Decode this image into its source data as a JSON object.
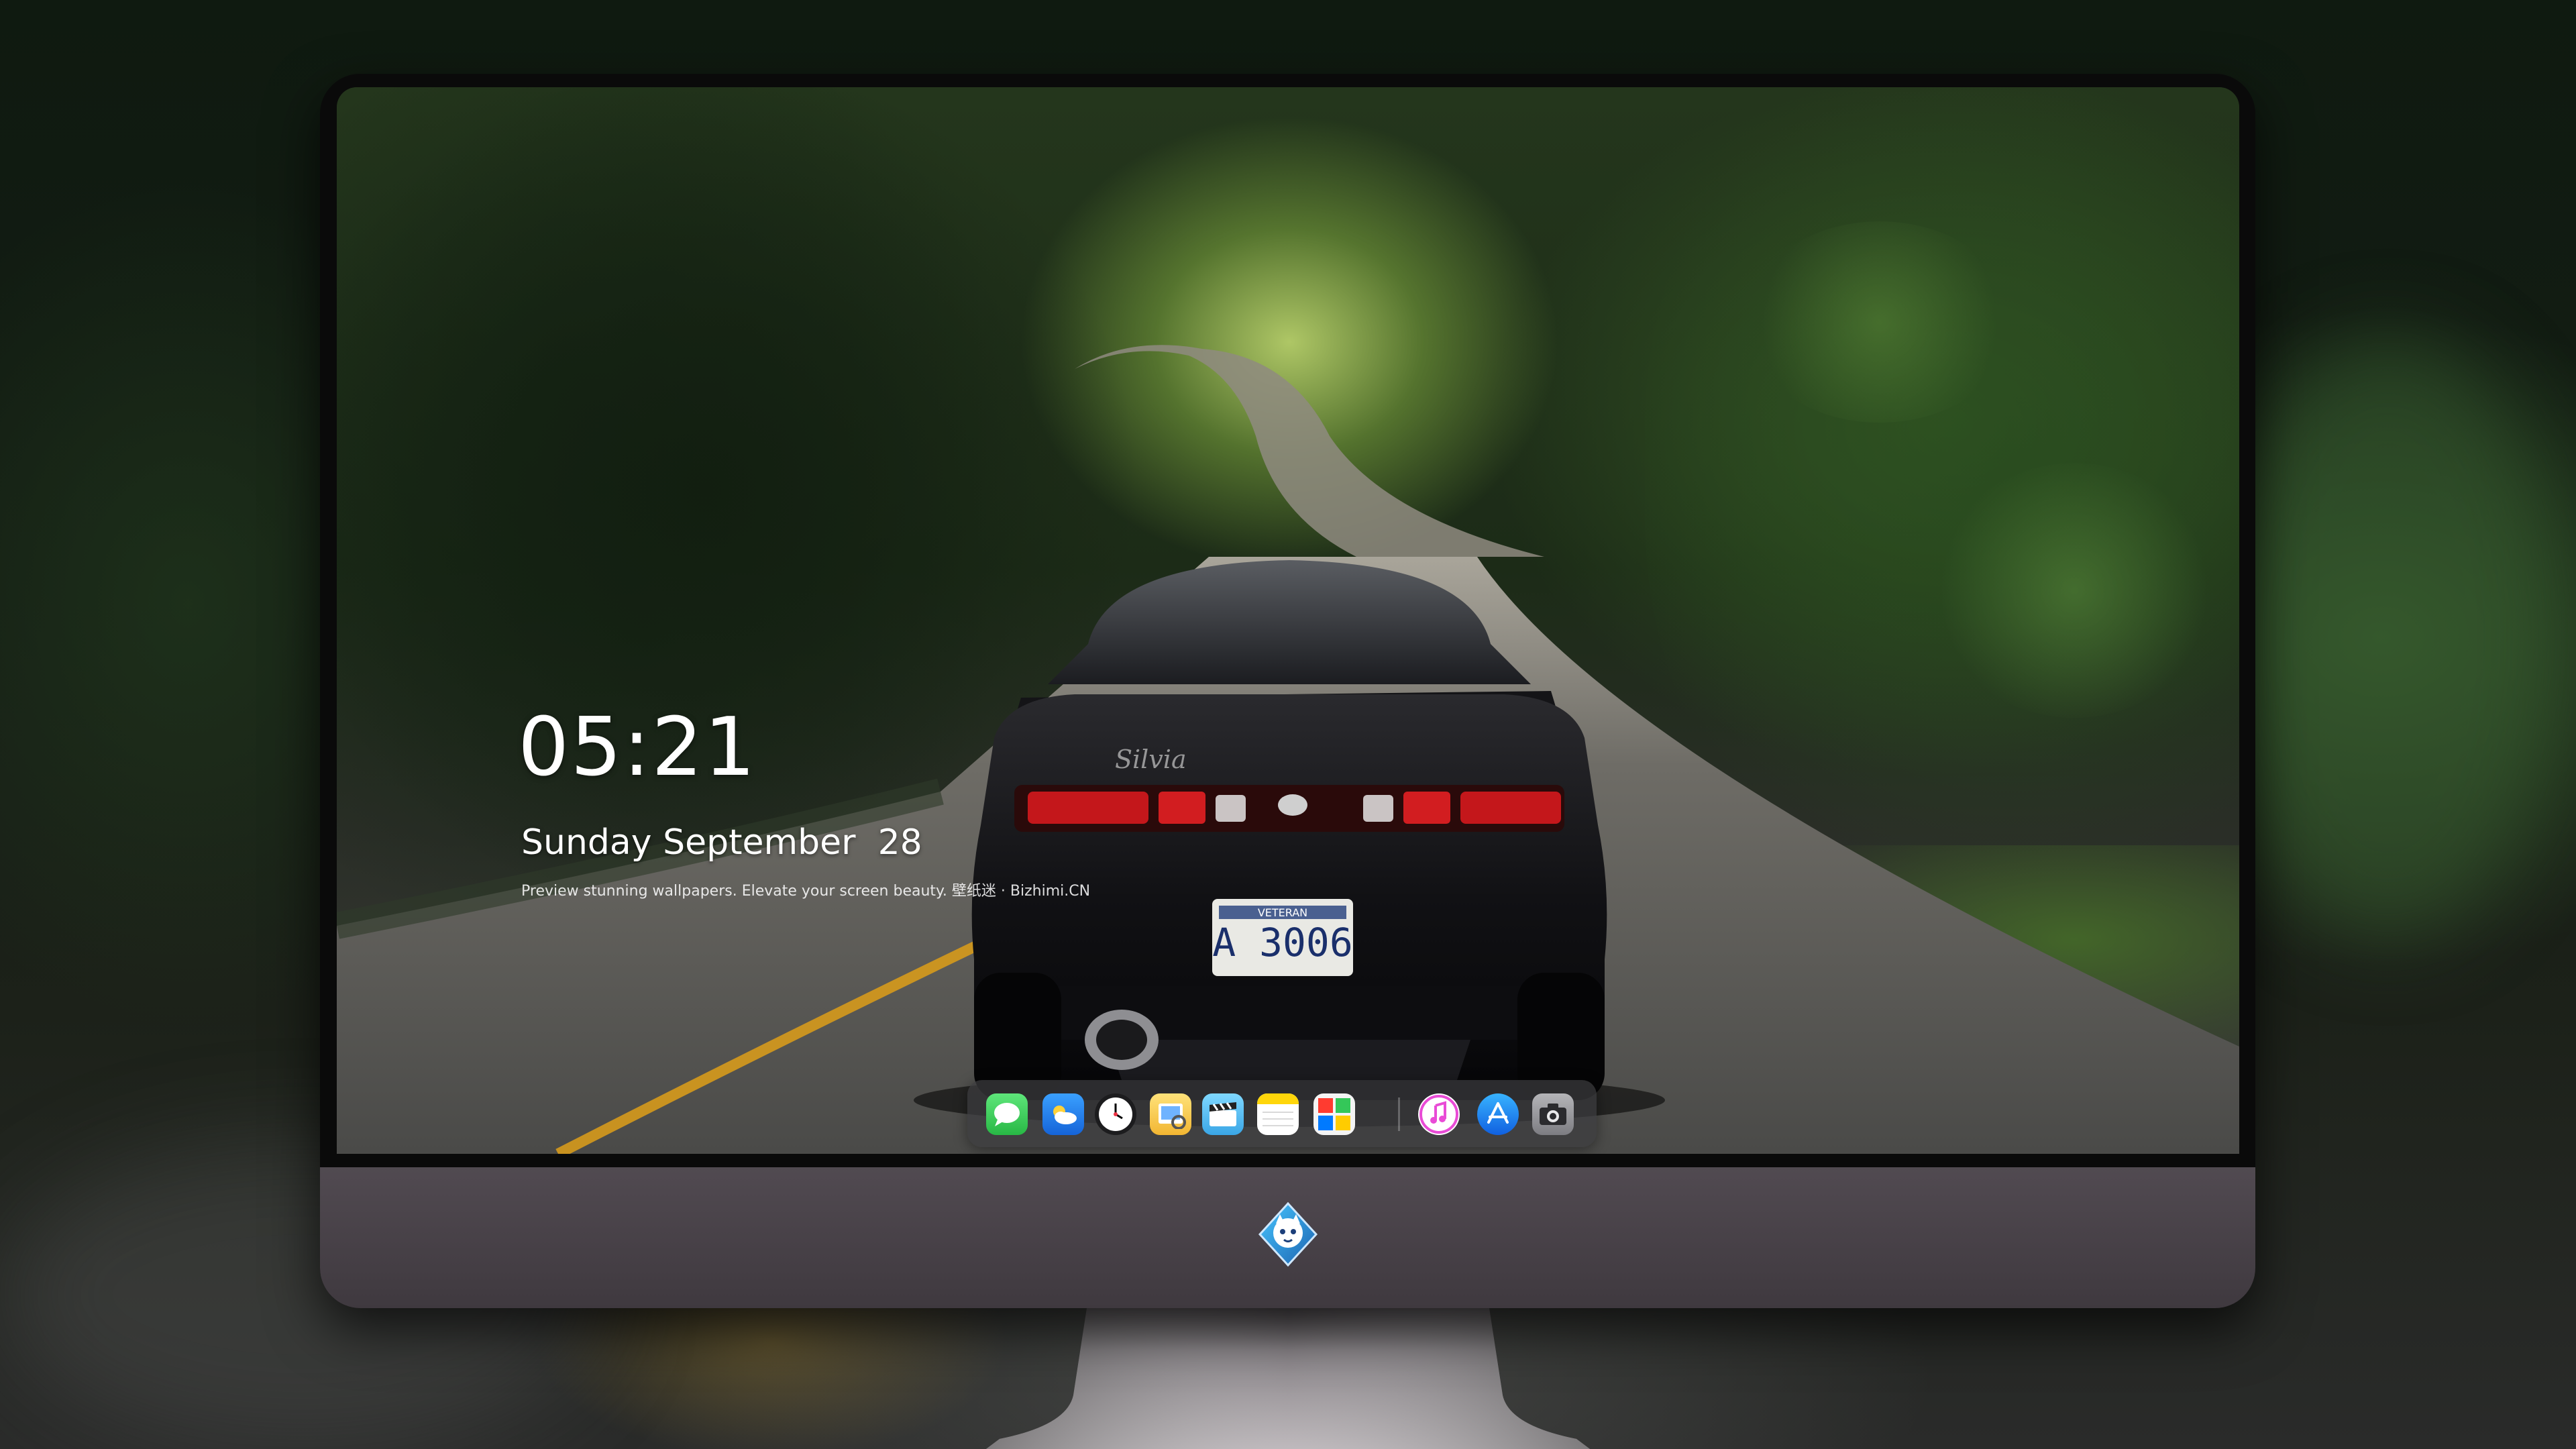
{
  "lockscreen": {
    "time": "05:21",
    "date": "Sunday September  28",
    "tagline": "Preview stunning wallpapers. Elevate your screen beauty. 壁纸迷 · Bizhimi.CN"
  },
  "wallpaper": {
    "subject": "sports-car-on-forest-road",
    "license_plate": "A 3006",
    "plate_header": "VETERAN"
  },
  "dock": {
    "apps": [
      {
        "name": "Messages",
        "icon": "messages-icon",
        "color": "#34c759"
      },
      {
        "name": "Weather",
        "icon": "weather-icon",
        "color": "#1e90ff"
      },
      {
        "name": "Clock",
        "icon": "clock-icon",
        "color": "#1c1c1e"
      },
      {
        "name": "Preview",
        "icon": "preview-icon",
        "color": "#f2c94c"
      },
      {
        "name": "Clips",
        "icon": "clapperboard-icon",
        "color": "#5ac8fa"
      },
      {
        "name": "Notes",
        "icon": "notes-icon",
        "color": "#ffd60a"
      },
      {
        "name": "Photo Booth",
        "icon": "photo-booth-icon",
        "color": "#ff3b30"
      },
      {
        "name": "iTunes",
        "icon": "music-icon",
        "color": "#e94bd6"
      },
      {
        "name": "App Store",
        "icon": "app-store-icon",
        "color": "#1e8cff"
      },
      {
        "name": "Camera",
        "icon": "camera-icon",
        "color": "#8e8e93"
      }
    ]
  },
  "colors": {
    "bezel": "#0a0a0a",
    "chin": "#4a444a",
    "stand": "#9a9598"
  }
}
